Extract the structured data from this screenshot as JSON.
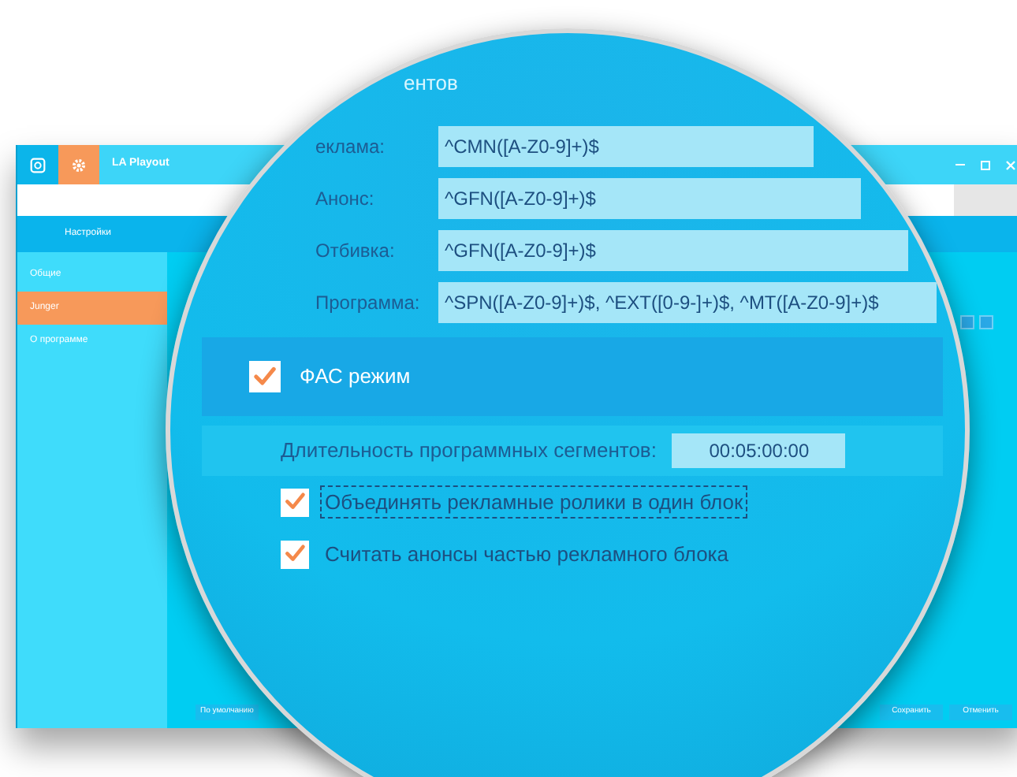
{
  "window": {
    "title": "LA Playout",
    "tabs": [
      {
        "kind": "logo",
        "selected": false
      },
      {
        "kind": "settings",
        "selected": true
      }
    ]
  },
  "sidebar": {
    "heading": "Настройки",
    "items": [
      {
        "label": "Общие",
        "selected": false
      },
      {
        "label": "Junger",
        "selected": true
      },
      {
        "label": "О программе",
        "selected": false
      }
    ]
  },
  "footer": {
    "default_button": "По умолчанию",
    "buttons": [
      "Сохранить",
      "Отменить"
    ]
  },
  "magnifier": {
    "title_fragment": "ентов",
    "fields": [
      {
        "label": "еклама:",
        "value": "^CMN([A-Z0-9]+)$"
      },
      {
        "label": "Анонс:",
        "value": "^GFN([A-Z0-9]+)$"
      },
      {
        "label": "Отбивка:",
        "value": "^GFN([A-Z0-9]+)$"
      },
      {
        "label": "Программа:",
        "value": "^SPN([A-Z0-9]+)$, ^EXT([0-9-]+)$, ^MT([A-Z0-9]+)$"
      }
    ],
    "fas": {
      "label": "ФАС режим",
      "checked": true
    },
    "duration": {
      "label": "Длительность программных сегментов:",
      "value": "00:05:00:00"
    },
    "options": [
      {
        "label": "Объединять рекламные ролики в один блок",
        "checked": true,
        "focused": true
      },
      {
        "label": "Считать анонсы частью рекламного блока",
        "checked": true,
        "focused": false
      }
    ]
  }
}
